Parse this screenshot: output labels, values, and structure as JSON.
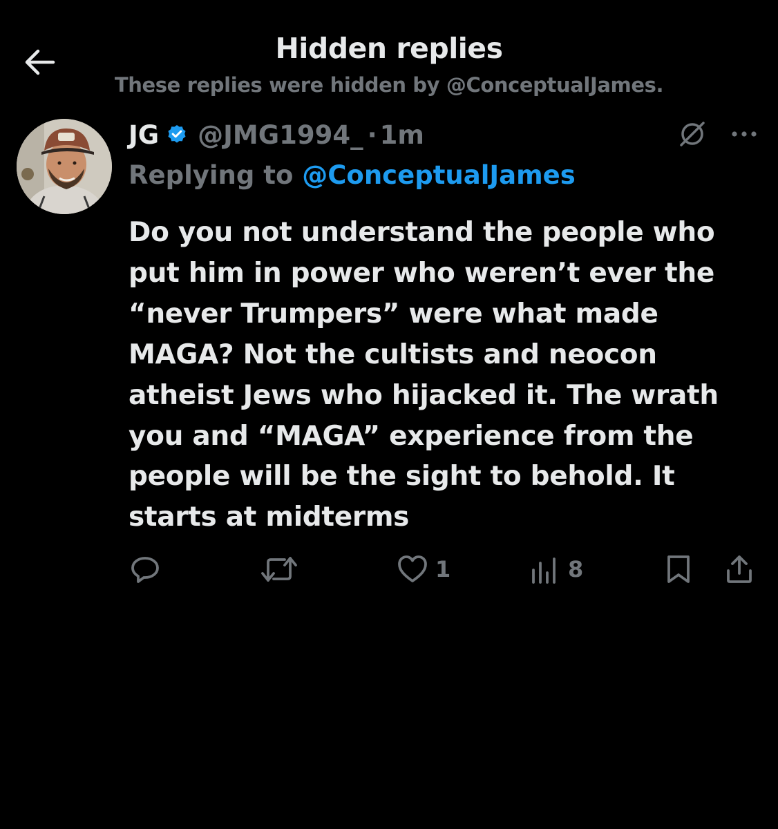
{
  "header": {
    "back_icon": "arrow-left-icon",
    "title": "Hidden replies",
    "subtitle": "These replies were hidden by @ConceptualJames."
  },
  "tweet": {
    "author": {
      "display_name": "JG",
      "handle": "@JMG1994_",
      "verified_icon": "verified-badge-icon",
      "avatar_icon": "avatar"
    },
    "separator": "·",
    "timestamp": "1m",
    "replying_prefix": "Replying to",
    "replying_to": "@ConceptualJames",
    "text_lines": [
      "Do you not understand the people who",
      "put him in power who weren’t ever the",
      "“never Trumpers” were what made",
      "MAGA? Not the cultists and neocon",
      "atheist Jews who hijacked it. The wrath",
      "you and “MAGA” experience from the",
      "people will be the sight to behold. It",
      "starts at midterms"
    ],
    "actions": {
      "reply": {
        "icon": "reply-icon",
        "count": ""
      },
      "repost": {
        "icon": "repost-icon",
        "count": ""
      },
      "like": {
        "icon": "heart-icon",
        "count": "1"
      },
      "views": {
        "icon": "views-icon",
        "count": "8"
      },
      "bookmark": {
        "icon": "bookmark-icon"
      },
      "share": {
        "icon": "share-icon"
      }
    }
  },
  "colors": {
    "background": "#000000",
    "primary_text": "#e7e9ea",
    "secondary_text": "#71767b",
    "accent": "#1d9bf0"
  }
}
